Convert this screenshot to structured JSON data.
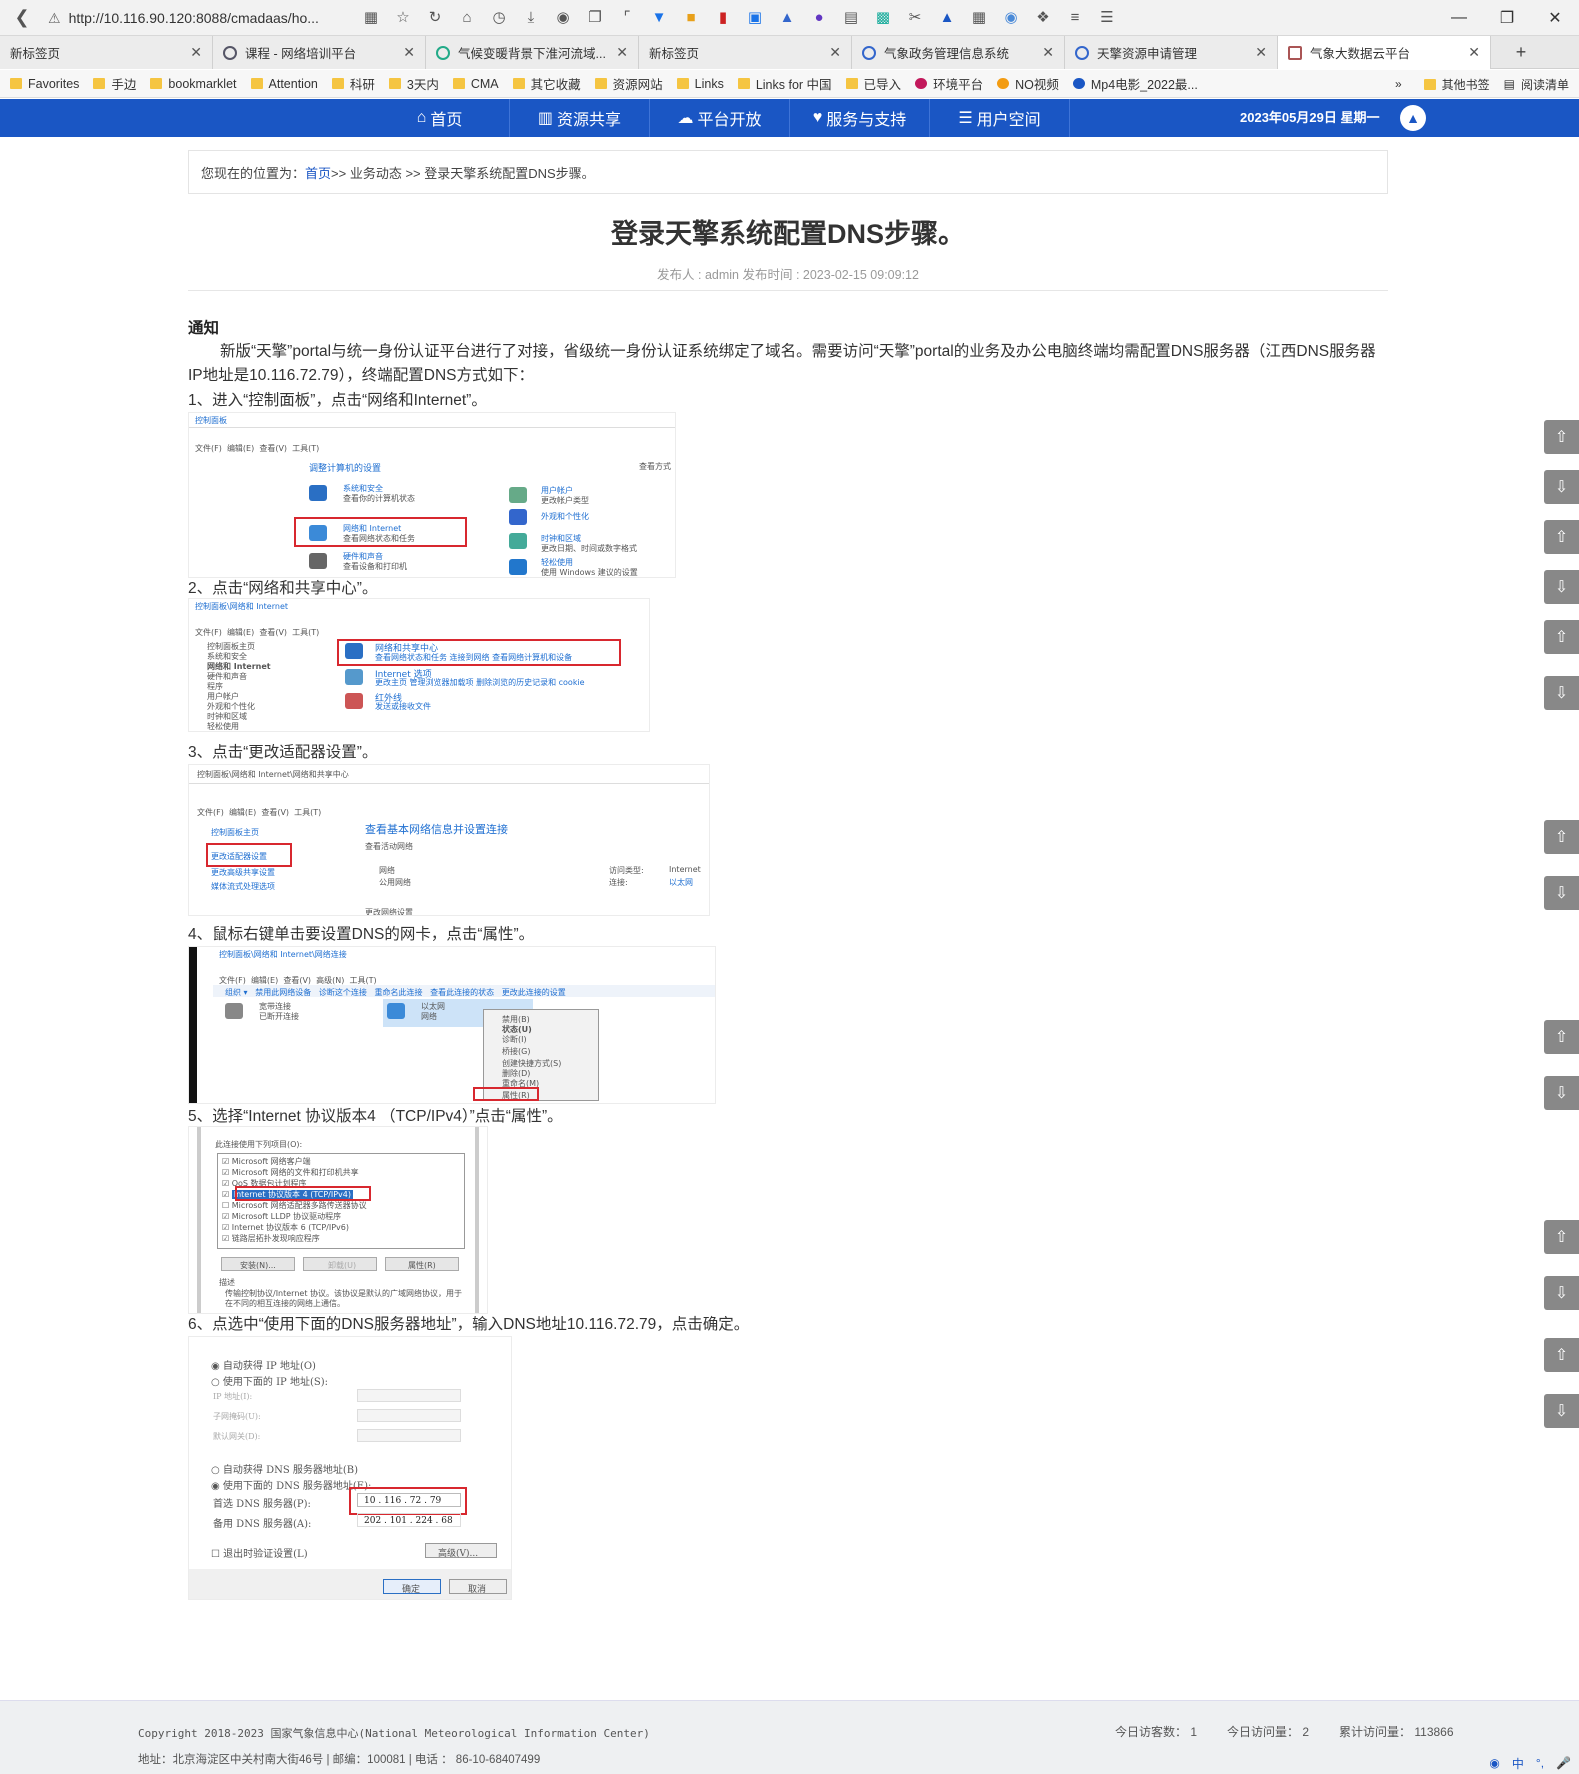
{
  "browser": {
    "url": "http://10.116.90.120:8088/cmadaas/ho...",
    "tabs": [
      {
        "title": "新标签页",
        "active": false
      },
      {
        "title": "课程 - 网络培训平台",
        "active": false
      },
      {
        "title": "气候变暖背景下淮河流域...",
        "active": false
      },
      {
        "title": "新标签页",
        "active": false
      },
      {
        "title": "气象政务管理信息系统",
        "active": false
      },
      {
        "title": "天擎资源申请管理",
        "active": false
      },
      {
        "title": "气象大数据云平台",
        "active": true
      }
    ],
    "bookmarks": [
      "Favorites",
      "手边",
      "bookmarklet",
      "Attention",
      "科研",
      "3天内",
      "CMA",
      "其它收藏",
      "资源网站",
      "Links",
      "Links for 中国",
      "已导入",
      "环境平台",
      "NO视频",
      "Mp4电影_2022最..."
    ],
    "bookmarks_right": [
      "其他书签",
      "阅读清单"
    ]
  },
  "sitenav": {
    "items": [
      "首页",
      "资源共享",
      "平台开放",
      "服务与支持",
      "用户空间"
    ],
    "date": "2023年05月29日  星期一"
  },
  "breadcrumb": {
    "prefix": "您现在的位置为：",
    "home": "首页",
    "rest": " >> 业务动态 >> 登录天擎系统配置DNS步骤。"
  },
  "article": {
    "title": "登录天擎系统配置DNS步骤。",
    "meta": "发布人 : admin   发布时间 : 2023-02-15 09:09:12",
    "notice_heading": "通知",
    "intro": "新版“天擎”portal与统一身份认证平台进行了对接，省级统一身份认证系统绑定了域名。需要访问“天擎”portal的业务及办公电脑终端均需配置DNS服务器（江西DNS服务器IP地址是10.116.72.79），终端配置DNS方式如下：",
    "steps": [
      "1、进入“控制面板”，点击“网络和Internet”。",
      "2、点击“网络和共享中心”。",
      "3、点击“更改适配器设置”。",
      "4、鼠标右键单击要设置DNS的网卡，点击“属性”。",
      "5、选择“Internet 协议版本4 （TCP/IPv4）”点击“属性”。",
      "6、点选中“使用下面的DNS服务器地址”，输入DNS地址10.116.72.79，点击确定。"
    ]
  },
  "shots": {
    "s1": {
      "path": "控制面板",
      "menu": [
        "文件(F)",
        "编辑(E)",
        "查看(V)",
        "工具(T)"
      ],
      "heading": "调整计算机的设置",
      "view": "查看方式",
      "left": [
        {
          "title": "系统和安全",
          "sub": "查看你的计算机状态"
        },
        {
          "title": "网络和 Internet",
          "sub": "查看网络状态和任务"
        },
        {
          "title": "硬件和声音",
          "sub": "查看设备和打印机"
        }
      ],
      "right": [
        {
          "title": "用户帐户",
          "sub": "更改帐户类型"
        },
        {
          "title": "外观和个性化",
          "sub": ""
        },
        {
          "title": "时钟和区域",
          "sub": "更改日期、时间或数字格式"
        },
        {
          "title": "轻松使用",
          "sub": "使用 Windows 建议的设置"
        }
      ]
    },
    "s2": {
      "path": "控制面板\\网络和 Internet",
      "menu": [
        "文件(F)",
        "编辑(E)",
        "查看(V)",
        "工具(T)"
      ],
      "side": [
        "控制面板主页",
        "系统和安全",
        "网络和 Internet",
        "硬件和声音",
        "程序",
        "用户帐户",
        "外观和个性化",
        "时钟和区域",
        "轻松使用"
      ],
      "main": [
        {
          "title": "网络和共享中心",
          "sub": "查看网络状态和任务    连接到网络    查看网络计算机和设备"
        },
        {
          "title": "Internet 选项",
          "sub": "更改主页    管理浏览器加载项    删除浏览的历史记录和 cookie"
        },
        {
          "title": "红外线",
          "sub": "发送或接收文件"
        }
      ]
    },
    "s3": {
      "path": "控制面板\\网络和 Internet\\网络和共享中心",
      "menu": [
        "文件(F)",
        "编辑(E)",
        "查看(V)",
        "工具(T)"
      ],
      "side": [
        "控制面板主页",
        "更改适配器设置",
        "更改高级共享设置",
        "媒体流式处理选项"
      ],
      "heading": "查看基本网络信息并设置连接",
      "active": "查看活动网络",
      "net": "网络",
      "net_type": "公用网络",
      "access_label": "访问类型:",
      "access_val": "Internet",
      "conn_label": "连接:",
      "conn_val": "以太网",
      "change": "更改网络设置"
    },
    "s4": {
      "path": "控制面板\\网络和 Internet\\网络连接",
      "menu": [
        "文件(F)",
        "编辑(E)",
        "查看(V)",
        "高级(N)",
        "工具(T)"
      ],
      "cmds": [
        "组织 ▾",
        "禁用此网络设备",
        "诊断这个连接",
        "重命名此连接",
        "查看此连接的状态",
        "更改此连接的设置"
      ],
      "adapter1": "宽带连接",
      "adapter1_sub": "已断开连接",
      "adapter2": "以太网",
      "adapter2_sub": "网络",
      "ctx": [
        "禁用(B)",
        "状态(U)",
        "诊断(I)",
        "桥接(G)",
        "创建快捷方式(S)",
        "删除(D)",
        "重命名(M)",
        "属性(R)"
      ]
    },
    "s5": {
      "heading": "此连接使用下列项目(O):",
      "items": [
        "Microsoft 网络客户端",
        "Microsoft 网络的文件和打印机共享",
        "QoS 数据包计划程序",
        "Internet 协议版本 4 (TCP/IPv4)",
        "Microsoft 网络适配器多路传送器协议",
        "Microsoft LLDP 协议驱动程序",
        "Internet 协议版本 6 (TCP/IPv6)",
        "链路层拓扑发现响应程序"
      ],
      "buttons": [
        "安装(N)...",
        "卸载(U)",
        "属性(R)"
      ],
      "desc_label": "描述",
      "desc": "传输控制协议/Internet 协议。该协议是默认的广域网络协议，用于在不同的相互连接的网络上通信。"
    },
    "s6": {
      "auto_ip": "自动获得 IP 地址(O)",
      "use_ip": "使用下面的 IP 地址(S):",
      "ip_label": "IP 地址(I):",
      "mask_label": "子网掩码(U):",
      "gw_label": "默认网关(D):",
      "auto_dns": "自动获得 DNS 服务器地址(B)",
      "use_dns": "使用下面的 DNS 服务器地址(E):",
      "pref_label": "首选 DNS 服务器(P):",
      "pref_val": "10 . 116 . 72 . 79",
      "alt_label": "备用 DNS 服务器(A):",
      "alt_val": "202 . 101 . 224 . 68",
      "validate": "退出时验证设置(L)",
      "advanced": "高级(V)...",
      "ok": "确定",
      "cancel": "取消"
    }
  },
  "footer": {
    "copyright": "Copyright 2018-2023 国家气象信息中心(National Meteorological Information Center)",
    "address": "地址：北京海淀区中关村南大街46号 | 邮编：100081 | 电话 ： 86-10-68407499",
    "stats": [
      "今日访客数： 1",
      "今日访问量： 2",
      "累计访问量： 113866"
    ]
  },
  "ime": [
    "中",
    "°,",
    "🎤"
  ]
}
